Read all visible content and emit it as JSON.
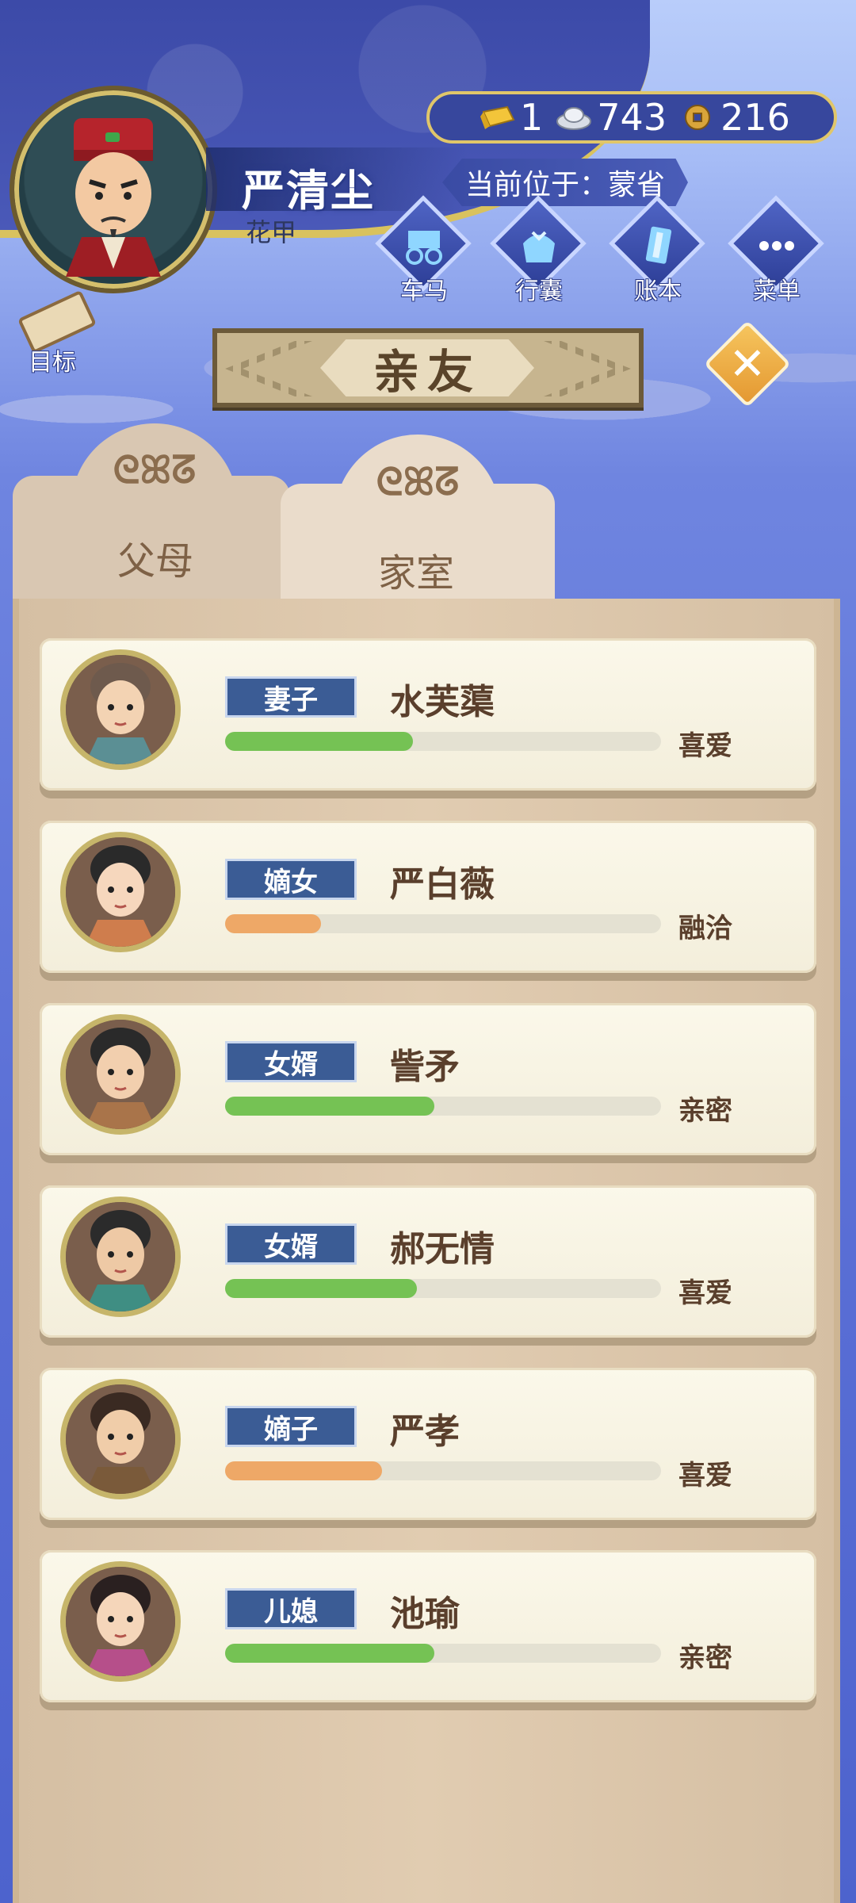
{
  "player": {
    "name": "严清尘",
    "age_label": "花甲",
    "location": "当前位于：蒙省"
  },
  "currency": {
    "gold": "1",
    "silver": "743",
    "coins": "216"
  },
  "actions": [
    {
      "label": "车马",
      "icon": "carriage-icon"
    },
    {
      "label": "行囊",
      "icon": "bundle-icon"
    },
    {
      "label": "账本",
      "icon": "ledger-icon"
    },
    {
      "label": "菜单",
      "icon": "menu-dots-icon"
    }
  ],
  "goal_label": "目标",
  "title": "亲友",
  "tabs": {
    "parents": "父母",
    "family": "家室"
  },
  "colors": {
    "bar_green": "#75c254",
    "bar_orange": "#eea867",
    "role_badge": "#3b5c95"
  },
  "members": [
    {
      "role": "妻子",
      "name": "水芙蕖",
      "relation": "喜爱",
      "affinity": 0.43,
      "bar": "green"
    },
    {
      "role": "嫡女",
      "name": "严白薇",
      "relation": "融洽",
      "affinity": 0.22,
      "bar": "orange"
    },
    {
      "role": "女婿",
      "name": "訾矛",
      "relation": "亲密",
      "affinity": 0.48,
      "bar": "green"
    },
    {
      "role": "女婿",
      "name": "郝无情",
      "relation": "喜爱",
      "affinity": 0.44,
      "bar": "green"
    },
    {
      "role": "嫡子",
      "name": "严孝",
      "relation": "喜爱",
      "affinity": 0.36,
      "bar": "orange"
    },
    {
      "role": "儿媳",
      "name": "池瑜",
      "relation": "亲密",
      "affinity": 0.48,
      "bar": "green"
    }
  ]
}
